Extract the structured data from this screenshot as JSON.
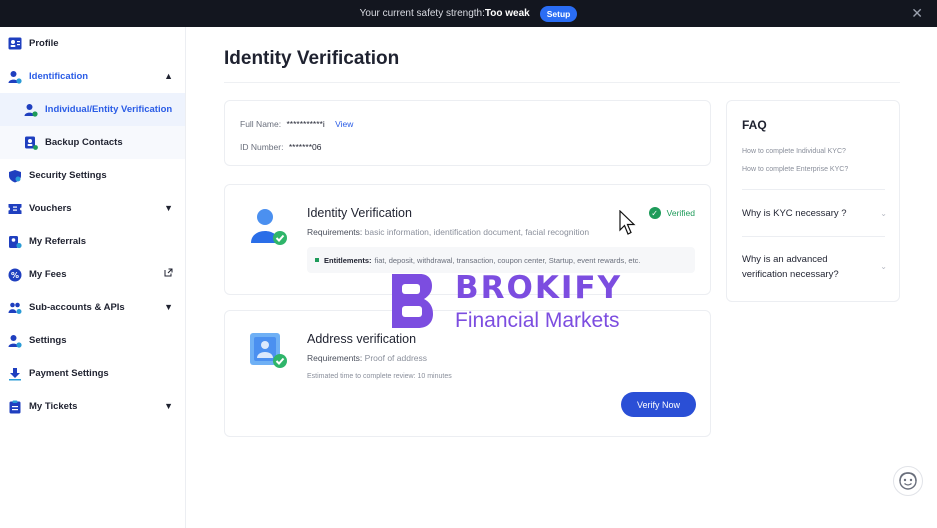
{
  "banner": {
    "text": "Your current safety strength:",
    "strength": "Too weak",
    "setup_label": "Setup"
  },
  "sidebar": {
    "items": [
      {
        "label": "Profile"
      },
      {
        "label": "Identification"
      },
      {
        "label": "Individual/Entity Verification"
      },
      {
        "label": "Backup Contacts"
      },
      {
        "label": "Security Settings"
      },
      {
        "label": "Vouchers"
      },
      {
        "label": "My Referrals"
      },
      {
        "label": "My Fees"
      },
      {
        "label": "Sub-accounts & APIs"
      },
      {
        "label": "Settings"
      },
      {
        "label": "Payment Settings"
      },
      {
        "label": "My Tickets"
      }
    ]
  },
  "main": {
    "title": "Identity Verification",
    "info": {
      "name_label": "Full Name:",
      "name_value": "***********i",
      "view_label": "View",
      "id_label": "ID Number:",
      "id_value": "*******06"
    },
    "kyc": {
      "title": "Identity Verification",
      "req_label": "Requirements:",
      "req_value": "basic information, identification document, facial recognition",
      "status": "Verified",
      "entitle_label": "Entitlements:",
      "entitle_value": "fiat, deposit, withdrawal, transaction, coupon center, Startup, event rewards, etc."
    },
    "address": {
      "title": "Address verification",
      "req_label": "Requirements:",
      "req_value": "Proof of address",
      "estimate": "Estimated time to complete review: 10 minutes",
      "button": "Verify Now"
    }
  },
  "faq": {
    "title": "FAQ",
    "links": [
      "How to complete Individual KYC?",
      "How to complete Enterprise KYC?"
    ],
    "questions": [
      "Why is KYC necessary ?",
      "Why is an advanced verification necessary?"
    ]
  },
  "watermark": {
    "brand": "BROKIFY",
    "sub": "Financial Markets"
  },
  "colors": {
    "accent": "#2a5ce6",
    "success": "#1e9b5a",
    "watermark": "#7c4de0"
  }
}
